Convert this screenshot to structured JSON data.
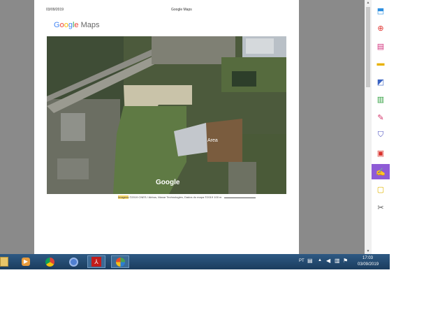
{
  "page_header": {
    "date": "03/09/2019",
    "title": "Google Maps"
  },
  "logo": {
    "g": "G",
    "o1": "o",
    "o2": "o",
    "g2": "g",
    "l": "l",
    "e": "e",
    "maps": "Maps"
  },
  "map": {
    "label_area": "Area",
    "watermark": "Google"
  },
  "attribution": {
    "imagens": "Imagens",
    "rest": "©2019 CNES / Airbus, Maxar Technologies, Dados do mapa ©2019",
    "scale": "100 m"
  },
  "taskbar": {
    "language": "PT",
    "time": "17:03",
    "date": "03/09/2019"
  },
  "icons": {
    "right_panel": [
      "export-pdf-icon",
      "create-pdf-icon",
      "organize-pages-icon",
      "comment-icon",
      "translate-icon",
      "compress-icon",
      "fill-sign-icon",
      "protect-icon",
      "pdf-icon",
      "sign-icon",
      "send-icon",
      "tools-icon"
    ],
    "taskbar": [
      "explorer-icon",
      "media-player-icon",
      "chrome-icon",
      "chrome-alt-icon",
      "acrobat-icon",
      "windows-live-icon"
    ]
  },
  "colors": {
    "taskbar": "#1b3c5e",
    "accent_purple": "#8e5bd6",
    "sign_active": "#8e5bd6"
  }
}
